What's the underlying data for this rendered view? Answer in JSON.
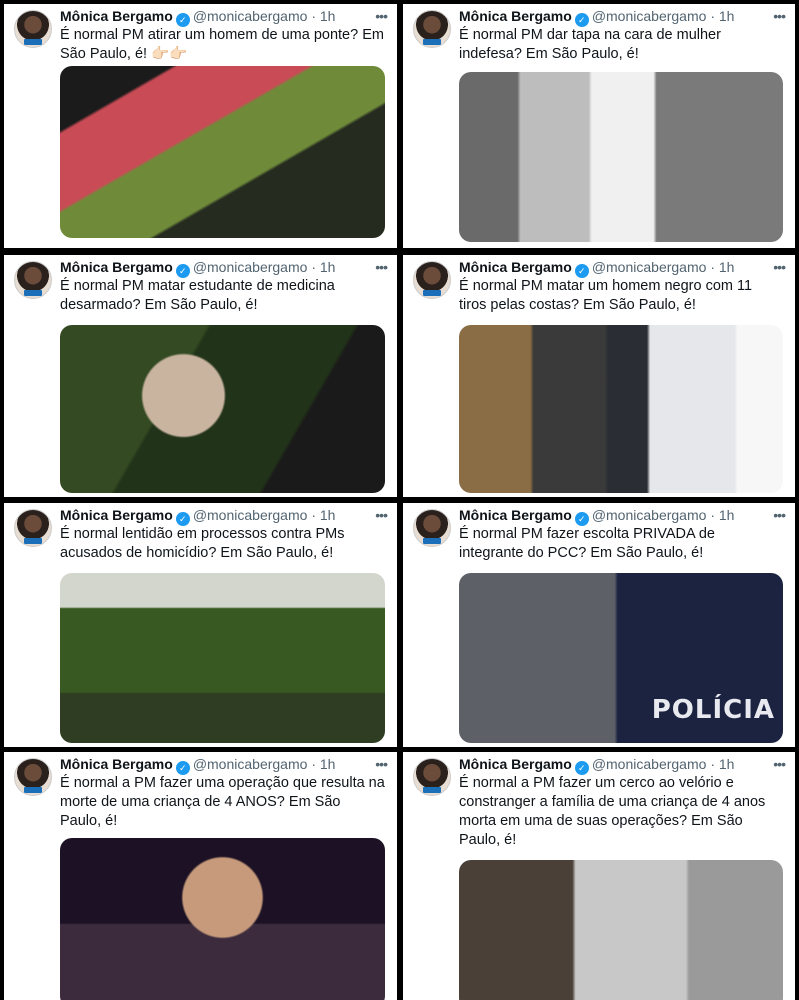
{
  "tweets": [
    {
      "name": "Mônica Bergamo",
      "handle": "@monicabergamo",
      "dot": "·",
      "time": "1h",
      "text": "É normal PM atirar um homem de uma ponte? Em São Paulo, é! 👉🏻👉🏻"
    },
    {
      "name": "Mônica Bergamo",
      "handle": "@monicabergamo",
      "dot": "·",
      "time": "1h",
      "text": "É normal PM dar tapa na cara de mulher indefesa? Em São Paulo, é!"
    },
    {
      "name": "Mônica Bergamo",
      "handle": "@monicabergamo",
      "dot": "·",
      "time": "1h",
      "text": "É normal PM matar estudante de medicina desarmado? Em São Paulo, é!"
    },
    {
      "name": "Mônica Bergamo",
      "handle": "@monicabergamo",
      "dot": "·",
      "time": "1h",
      "text": "É normal PM matar um homem negro com 11 tiros pelas costas? Em São Paulo, é!"
    },
    {
      "name": "Mônica Bergamo",
      "handle": "@monicabergamo",
      "dot": "·",
      "time": "1h",
      "text": "É normal lentidão em processos contra PMs acusados de homicídio? Em São Paulo, é!"
    },
    {
      "name": "Mônica Bergamo",
      "handle": "@monicabergamo",
      "dot": "·",
      "time": "1h",
      "text": "É normal PM fazer escolta PRIVADA de integrante do PCC? Em São Paulo, é!",
      "media_text": "POLÍCIA"
    },
    {
      "name": "Mônica Bergamo",
      "handle": "@monicabergamo",
      "dot": "·",
      "time": "1h",
      "text": "É normal a PM fazer uma operação que resulta na morte de uma criança de 4 ANOS? Em São Paulo, é!"
    },
    {
      "name": "Mônica Bergamo",
      "handle": "@monicabergamo",
      "dot": "·",
      "time": "1h",
      "text": "É normal a PM fazer um cerco ao velório e constranger a família de uma criança de 4 anos morta em uma de suas operações? Em São Paulo, é!"
    }
  ],
  "icons": {
    "more": "more-dots-icon",
    "verified": "verified-badge-icon"
  },
  "colors": {
    "verified": "#1d9bf0",
    "handle": "#536471",
    "text": "#0f1419"
  }
}
